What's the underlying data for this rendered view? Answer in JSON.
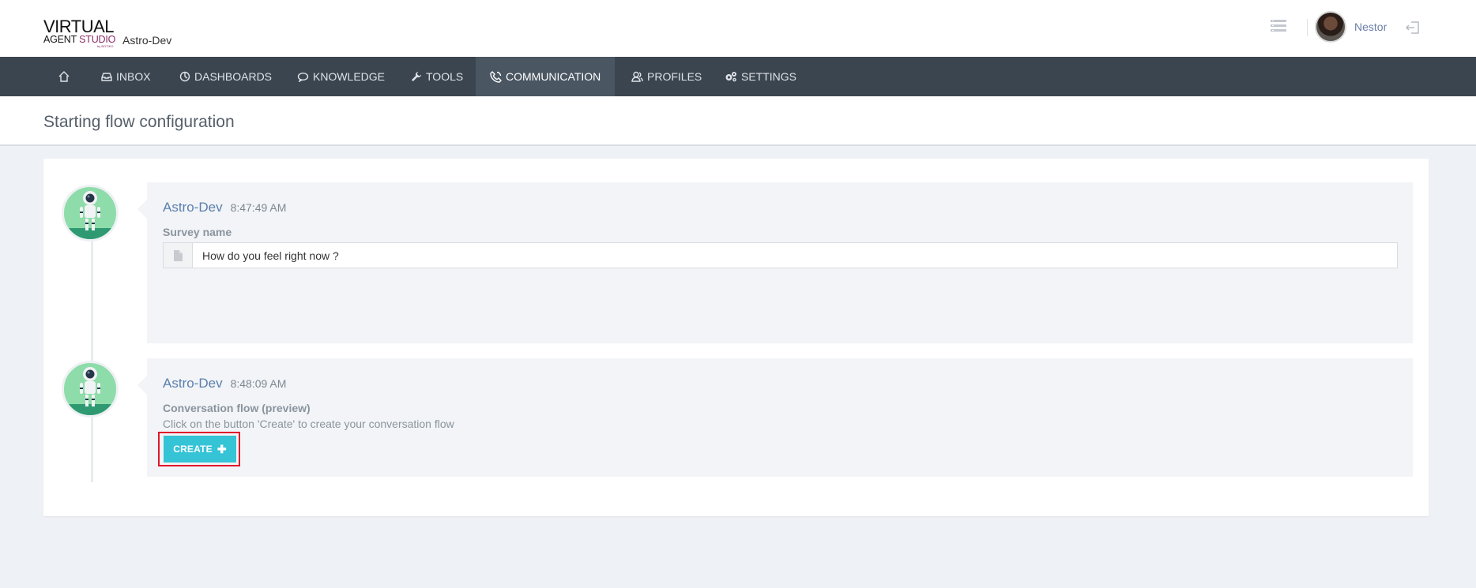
{
  "header": {
    "logo_line1": "VIRTUAL",
    "logo_agent": "AGENT",
    "logo_studio": "STUDIO",
    "logo_byline": "by BOTIKO",
    "tenant": "Astro-Dev",
    "username": "Nestor"
  },
  "nav": {
    "items": [
      {
        "label": "",
        "icon": "home-icon"
      },
      {
        "label": "INBOX",
        "icon": "inbox-icon"
      },
      {
        "label": "DASHBOARDS",
        "icon": "dashboard-icon"
      },
      {
        "label": "KNOWLEDGE",
        "icon": "chat-icon"
      },
      {
        "label": "TOOLS",
        "icon": "wrench-icon"
      },
      {
        "label": "COMMUNICATION",
        "icon": "phone-icon",
        "active": true
      },
      {
        "label": "PROFILES",
        "icon": "users-icon"
      },
      {
        "label": "SETTINGS",
        "icon": "gears-icon"
      }
    ]
  },
  "page": {
    "title": "Starting flow configuration"
  },
  "messages": [
    {
      "author": "Astro-Dev",
      "time": "8:47:49 AM",
      "field_label": "Survey name",
      "field_value": "How do you feel right now ?"
    },
    {
      "author": "Astro-Dev",
      "time": "8:48:09 AM",
      "field_label": "Conversation flow (preview)",
      "hint": "Click on the button 'Create' to create your conversation flow",
      "button_label": "CREATE"
    }
  ],
  "colors": {
    "nav_bg": "#3b4550",
    "accent": "#35c3d6",
    "author": "#5b7fae",
    "highlight": "#e0162b"
  }
}
